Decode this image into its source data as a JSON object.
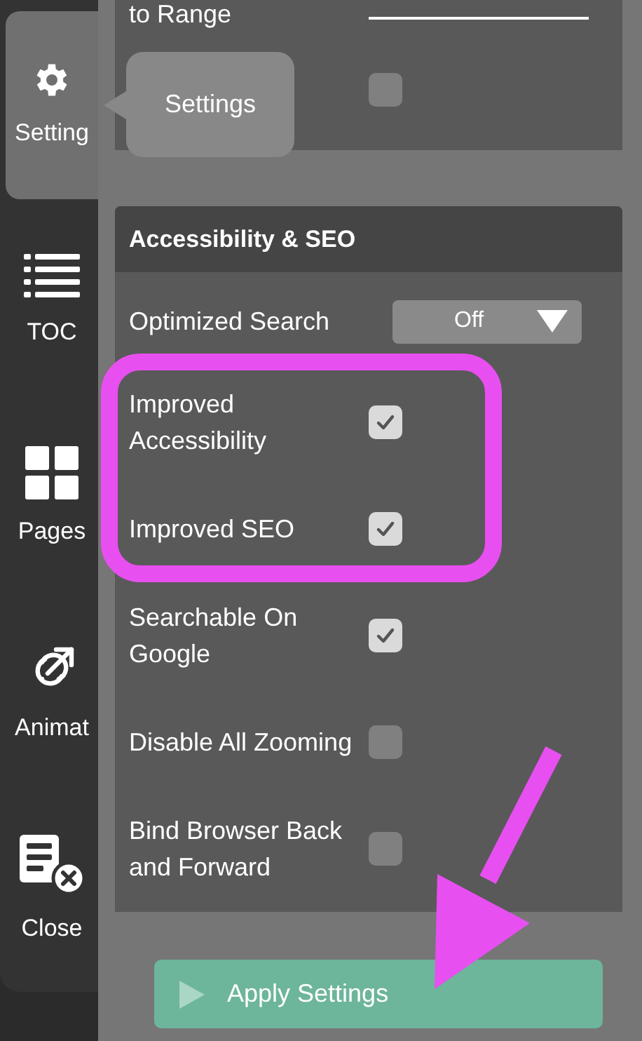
{
  "sidebar": {
    "items": [
      {
        "label": "Setting",
        "selected": true
      },
      {
        "label": "TOC",
        "selected": false
      },
      {
        "label": "Pages",
        "selected": false
      },
      {
        "label": "Animat",
        "selected": false
      },
      {
        "label": "Close",
        "selected": false
      }
    ]
  },
  "tooltip": {
    "text": "Settings"
  },
  "previous_section": {
    "rows": [
      {
        "kind": "field",
        "label": "to Range"
      },
      {
        "kind": "checkbox",
        "checked": false
      }
    ]
  },
  "section": {
    "title": "Accessibility & SEO",
    "rows": [
      {
        "kind": "select",
        "label": "Optimized Search",
        "value": "Off"
      },
      {
        "kind": "checkbox",
        "label": "Improved Accessibility",
        "checked": true
      },
      {
        "kind": "checkbox",
        "label": "Improved SEO",
        "checked": true
      },
      {
        "kind": "checkbox",
        "label": "Searchable On Google",
        "checked": true
      },
      {
        "kind": "checkbox",
        "label": "Disable All Zooming",
        "checked": false
      },
      {
        "kind": "checkbox",
        "label": "Bind Browser Back and Forward",
        "checked": false
      }
    ]
  },
  "apply_button": {
    "label": "Apply Settings"
  }
}
